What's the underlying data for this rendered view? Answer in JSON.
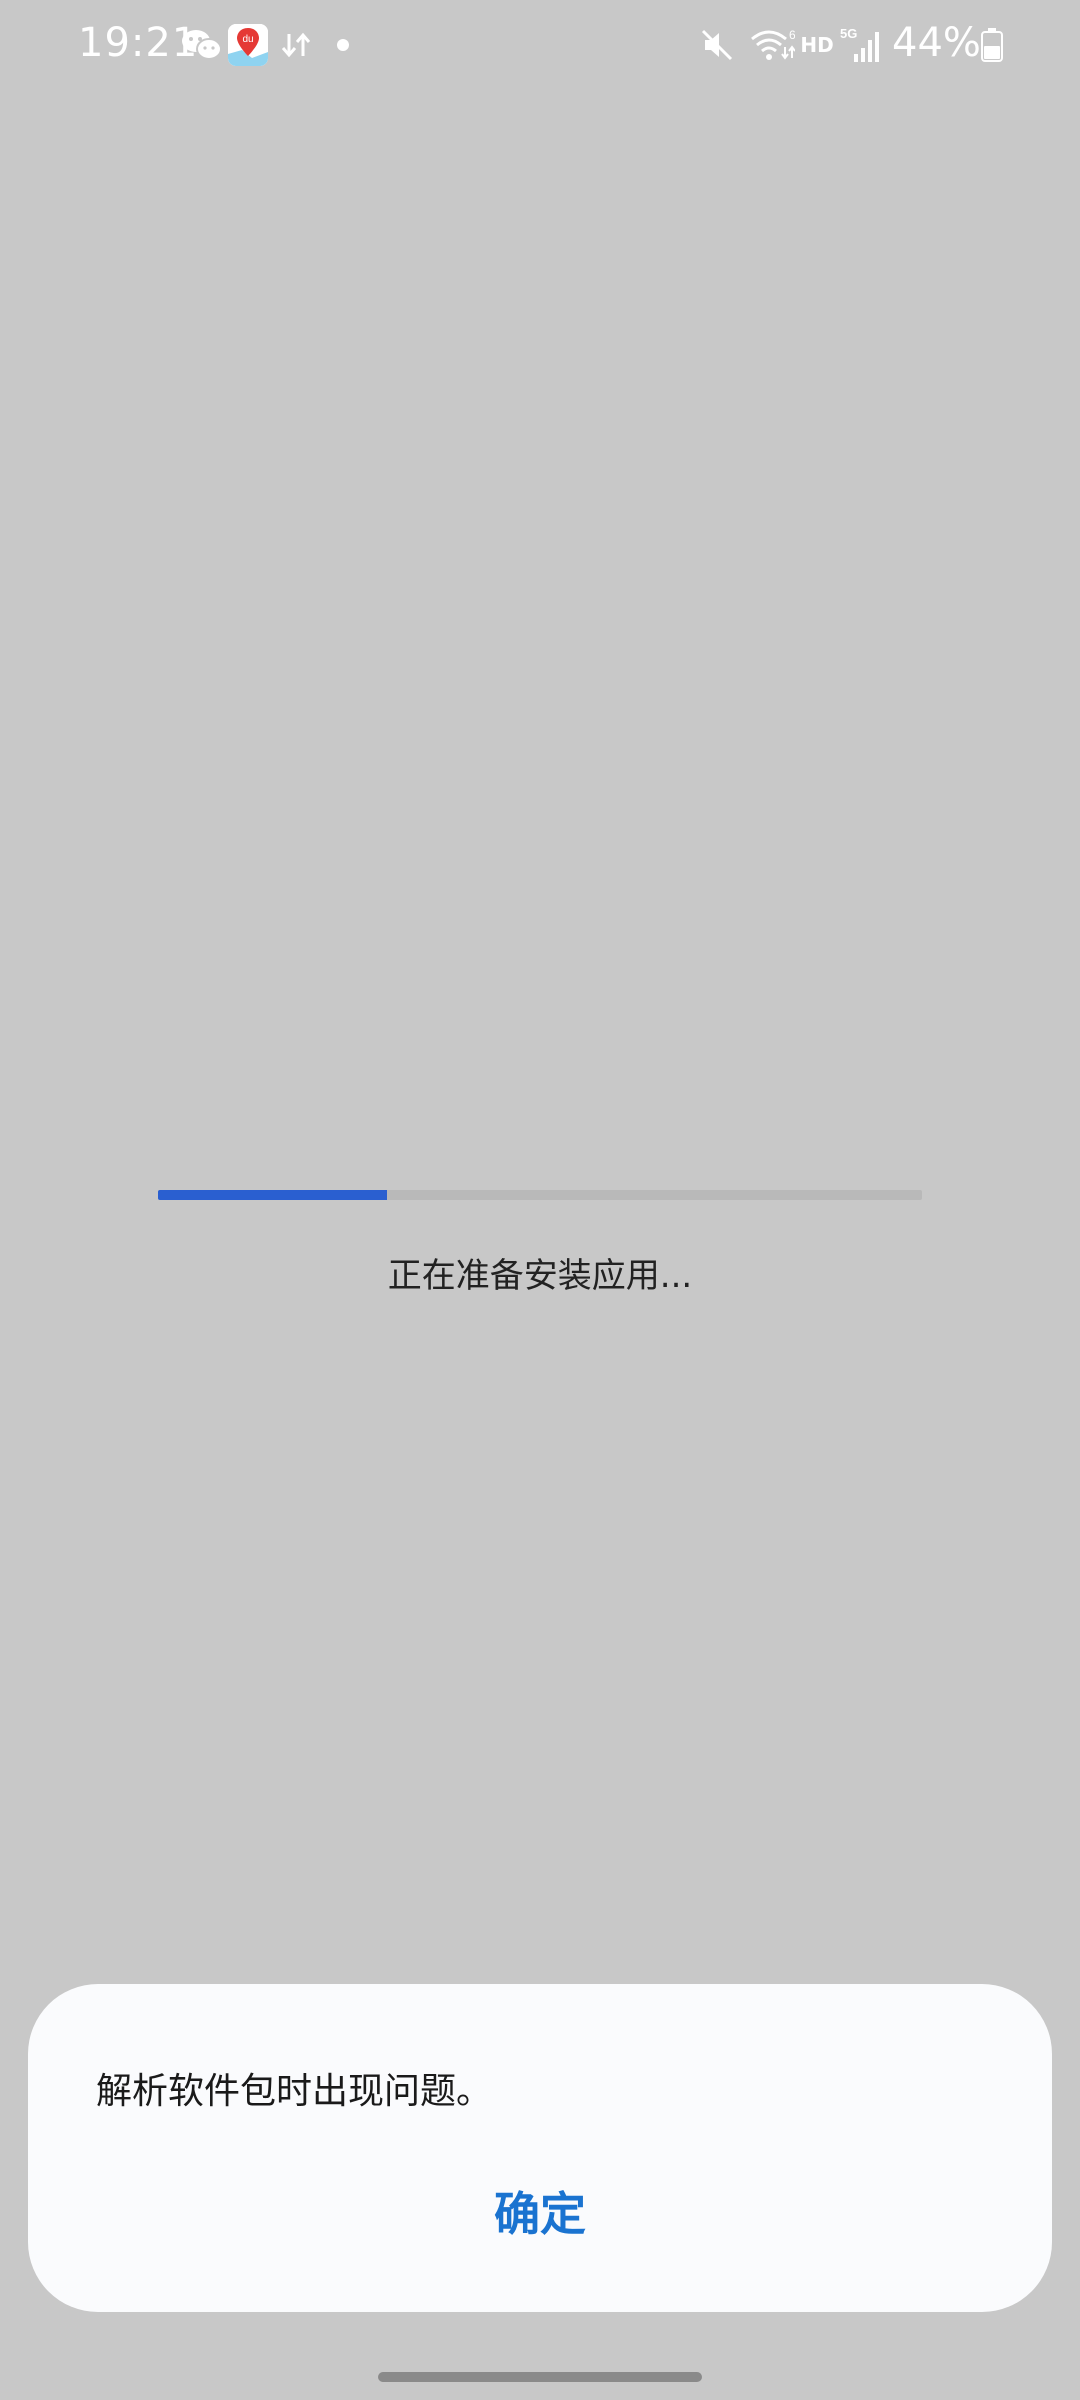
{
  "status_bar": {
    "time": "19:21",
    "battery_percent": "44%",
    "hd_label": "HD",
    "network_label": "5G",
    "maps_badge": "du",
    "battery_level": 0.44,
    "icons": [
      "wechat-icon",
      "baidu-maps-icon",
      "data-transfer-icon",
      "notification-dot-icon",
      "mute-icon",
      "wifi-icon",
      "signal-icon",
      "battery-icon"
    ]
  },
  "install": {
    "progress_text": "正在准备安装应用...",
    "progress": 0.3,
    "progress_color": "#2a5fd0"
  },
  "dialog": {
    "message": "解析软件包时出现问题。",
    "confirm_label": "确定",
    "confirm_color": "#1a73d0"
  }
}
